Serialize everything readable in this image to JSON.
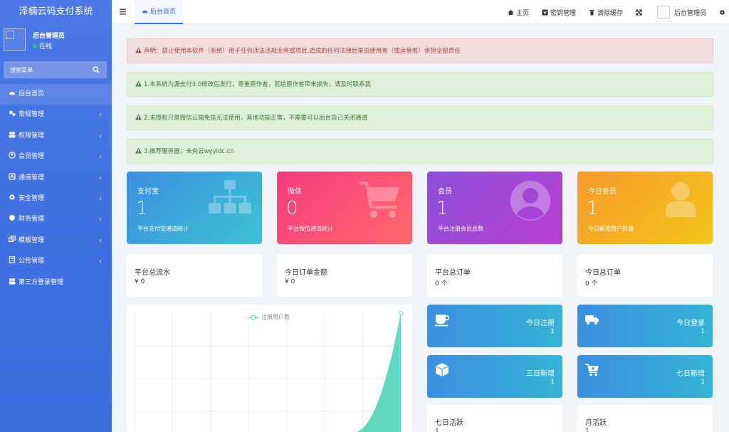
{
  "app": {
    "title": "泽楠云码支付系统"
  },
  "user": {
    "name": "后台管理员",
    "status": "在线"
  },
  "search": {
    "placeholder": "搜索菜单"
  },
  "sidebar": {
    "items": [
      {
        "label": "后台首页",
        "icon": "dashboard-icon",
        "active": true
      },
      {
        "label": "常规管理",
        "icon": "cogs-icon"
      },
      {
        "label": "权限管理",
        "icon": "users-icon"
      },
      {
        "label": "会员管理",
        "icon": "user-circle-icon"
      },
      {
        "label": "通道管理",
        "icon": "channel-icon"
      },
      {
        "label": "安全管理",
        "icon": "gear-icon"
      },
      {
        "label": "财务管理",
        "icon": "finance-icon"
      },
      {
        "label": "模板管理",
        "icon": "template-icon"
      },
      {
        "label": "公告管理",
        "icon": "notice-icon"
      },
      {
        "label": "第三方登录管理",
        "icon": "users-icon"
      }
    ],
    "chevron": "‹"
  },
  "topbar": {
    "active_tab": "后台首页",
    "links": {
      "home": "主页",
      "keys": "密钥管理",
      "cache": "清除缓存",
      "admin": "后台管理员"
    }
  },
  "alerts": {
    "notice": "声明：禁止使用本软件（系统）用于任何违法违规业务或项目,造成的任何法律后果由使用者（或运营者）承担全部责任",
    "a1": "1.本系统为源支付3.0修改后发行，尊重原作者，若给原作者带来损失，请及时联系我",
    "a2": "2.未授权只是微信云端免挂无法使用，其他功能正常，不需要可以后台自己关闭通道",
    "a3": "3.推荐服务器：未央云wyyidc.cn"
  },
  "cards": {
    "alipay": {
      "title": "支付宝",
      "value": "1",
      "desc": "平台支付宝通道统计"
    },
    "wechat": {
      "title": "微信",
      "value": "0",
      "desc": "平台微信通道统计"
    },
    "member": {
      "title": "会员",
      "value": "1",
      "desc": "平台注册会员总数"
    },
    "today_member": {
      "title": "今日会员",
      "value": "1",
      "desc": "今日新增用户数量"
    }
  },
  "info": {
    "total_flow": {
      "label": "平台总流水",
      "value": "¥ 0"
    },
    "today_amount": {
      "label": "今日订单金额",
      "value": "¥ 0"
    },
    "total_orders": {
      "label": "平台总订单",
      "value": "0 个"
    },
    "today_orders": {
      "label": "今日总订单",
      "value": "0 个"
    }
  },
  "stats": {
    "today_reg": {
      "label": "今日注册",
      "value": "1"
    },
    "today_login": {
      "label": "今日登录",
      "value": "1"
    },
    "three_day": {
      "label": "三日新增",
      "value": "1"
    },
    "seven_day": {
      "label": "七日新增",
      "value": "1"
    },
    "seven_active": {
      "label": "七日活跃",
      "value": "1"
    },
    "month_active": {
      "label": "月活跃",
      "value": "1"
    }
  },
  "colors": {
    "sidebar": "#4a78e6",
    "card_alipay": "#3bb3d8",
    "card_wechat": "#fc3f7f",
    "card_member": "#9b49d6",
    "card_today": "#f4a81e",
    "chart_fill": "#5fd9c1"
  },
  "chart": {
    "legend": "注册用户数",
    "series": [
      0,
      0,
      0,
      0,
      0,
      0,
      0,
      1
    ]
  }
}
